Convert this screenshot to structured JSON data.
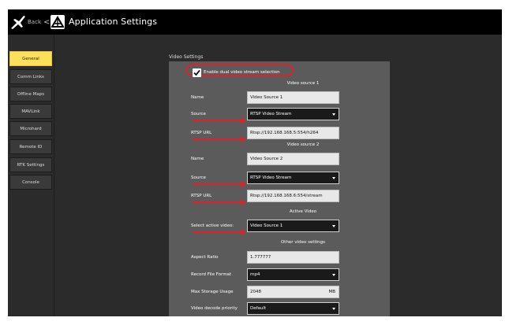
{
  "header": {
    "back_label": "Back",
    "back_chevron": "<",
    "title": "Application Settings",
    "logo_icon": "plane-logo-icon",
    "app_icon": "qgc-app-icon"
  },
  "sidebar": {
    "items": [
      {
        "label": "General",
        "active": true
      },
      {
        "label": "Comm Links"
      },
      {
        "label": "Offline Maps"
      },
      {
        "label": "MAVLink"
      },
      {
        "label": "Microhard"
      },
      {
        "label": "Remote ID"
      },
      {
        "label": "RTK Settings"
      },
      {
        "label": "Console"
      }
    ]
  },
  "video": {
    "section_title": "Video Settings",
    "dual_stream_checkbox": {
      "label": "Enable dual video stream selection",
      "checked": true
    },
    "source1": {
      "heading": "Video source 1",
      "name_label": "Name",
      "name_value": "Video Source 1",
      "source_label": "Source",
      "source_value": "RTSP Video Stream",
      "url_label": "RTSP URL",
      "url_value": "Rtsp://192.168.168.5:554/h264"
    },
    "source2": {
      "heading": "Video source 2",
      "name_label": "Name",
      "name_value": "Video Source 2",
      "source_label": "Source",
      "source_value": "RTSP Video Stream",
      "url_label": "RTSP URL",
      "url_value": "Rtsp://192.168.168.6:554/stream"
    },
    "active": {
      "heading": "Active Video",
      "select_label": "Select active video:",
      "select_value": "Video Source 1"
    },
    "other": {
      "heading": "Other video settings",
      "aspect_label": "Aspect Ratio",
      "aspect_value": "1.777777",
      "format_label": "Record File Format",
      "format_value": "mp4",
      "storage_label": "Max Storage Usage",
      "storage_value": "2048",
      "storage_unit": "MB",
      "decode_label": "Video decode priority",
      "decode_value": "Default"
    }
  },
  "colors": {
    "accent": "#fde05a",
    "annotation_red": "#e0202a",
    "panel": "#5b5b5b",
    "background": "#2b2b2b"
  }
}
